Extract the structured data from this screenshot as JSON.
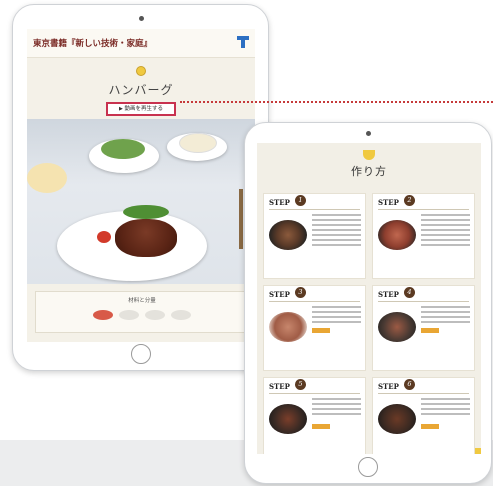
{
  "web_tablet": {
    "brand": "東京書籍『新しい技術・家庭』",
    "logo_label": "東京書籍",
    "recipe_title": "ハンバーグ",
    "play_button_label": "動画を再生する",
    "ingredients_heading": "材料と分量"
  },
  "howto_tablet": {
    "heading": "作り方",
    "steps": [
      {
        "label": "STEP",
        "num": "1"
      },
      {
        "label": "STEP",
        "num": "2"
      },
      {
        "label": "STEP",
        "num": "3"
      },
      {
        "label": "STEP",
        "num": "4"
      },
      {
        "label": "STEP",
        "num": "5"
      },
      {
        "label": "STEP",
        "num": "6"
      }
    ],
    "tip_label": "ポイント"
  },
  "colors": {
    "brand_text": "#7a2a25",
    "play_border": "#c8324f",
    "accent_yellow": "#f0c940",
    "step_badge": "#5b3a22"
  }
}
